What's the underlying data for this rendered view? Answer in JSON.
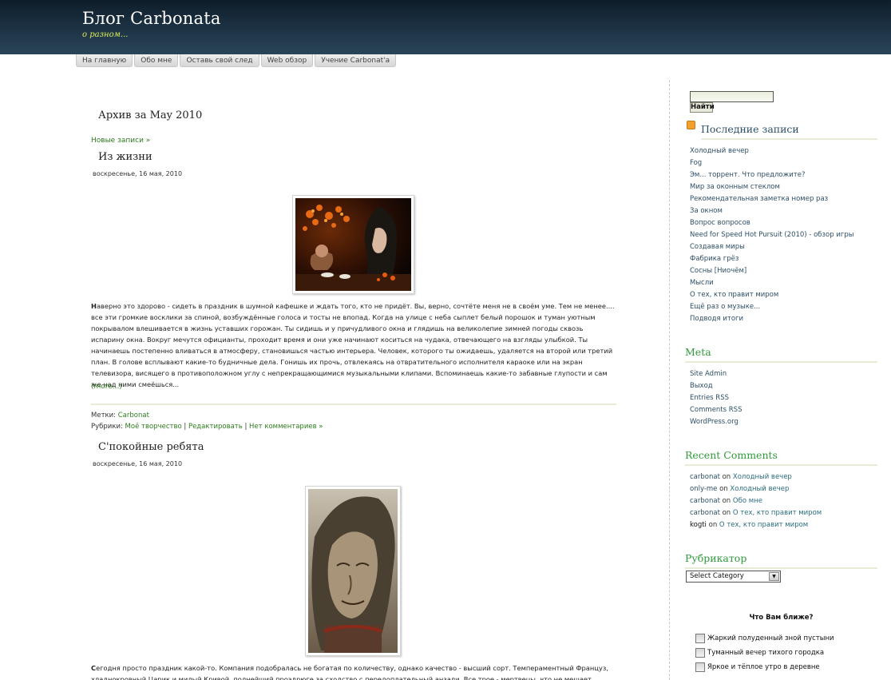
{
  "header": {
    "title": "Блог Carbonata",
    "tagline": "о разном..."
  },
  "nav": {
    "items": [
      {
        "label": "На главную"
      },
      {
        "label": "Обо мне"
      },
      {
        "label": "Оставь свой след"
      },
      {
        "label": "Web обзор"
      },
      {
        "label": "Учение Carbonat'a"
      }
    ]
  },
  "main": {
    "archive_title": "Архив за May 2010",
    "newer_link": "Новые записи »",
    "posts": [
      {
        "title": "Из жизни",
        "date": "воскресенье, 16 мая, 2010",
        "body_lead": "Н",
        "body": "аверно это здорово - сидеть в праздник в шумной кафешке и ждать того, кто не придёт. Вы, верно, сочтёте меня не в своём уме. Тем не менее.... все эти громкие восклики за спиной, возбуждённые голоса и тосты не впопад. Когда на улице с неба сыплет белый порошок и туман уютным покрывалом влешивается в жизнь уставших горожан. Ты сидишь и у причудливого окна и глядишь на великолепие зимней погоды сквозь испарину окна. Вокруг мечутся официанты, проходит время и они уже начинают коситься на чудака, отвечающего на взгляды улыбкой. Ты начинаешь постепенно вливаться в атмосферу, становишься частью интерьера. Человек, которого ты ожидаешь, удаляется на второй или третий план. В голове всплывают какие-то будничные дела. Гонишь их прочь, отвлекаясь на отвратительного исполнителя караоке или на экран телевизора, висящего в противоположном углу с непрекращающимися музыкальными клипами. Вспоминаешь какие-то забавные глупости и сам же над ними смеёшься...",
        "more": "(more...)",
        "tags_label": "Метки:",
        "tags": "Carbonat",
        "cats_label": "Рубрики:",
        "cats": "Моё творчество",
        "edit": "Редактировать",
        "comments": "Нет комментариев »"
      },
      {
        "title": "С'покойные ребята",
        "date": "воскресенье, 16 мая, 2010",
        "body_lead": "С",
        "body": "егодня просто праздник какой-то. Компания подобралась не богатая по  количеству, однако качество - высший сорт. Темпераментный Француз, хладнокровный Царик и милый Кривой, полнейший проэдрюге за сходство с  передоплательный анзали. Все трое - мертвецы, что не мешает играть в"
      }
    ]
  },
  "sidebar": {
    "search_button": "Найти",
    "recent_posts": {
      "title": "Последние записи",
      "items": [
        "Холодный вечер",
        "Fog",
        "Эм... торрент. Что предложите?",
        "Мир за оконным стеклом",
        "Рекомендательная заметка номер раз",
        "За окном",
        "Вопрос вопросов",
        "Need for Speed Hot Pursuit (2010) - обзор игры",
        "Создавая миры",
        "Фабрика грёз",
        "Сосны [Ниочём]",
        "Мысли",
        "О тех, кто правит миром",
        "Ещё раз о музыке...",
        "Подводя итоги"
      ]
    },
    "meta": {
      "title": "Meta",
      "items": [
        "Site Admin",
        "Выход",
        "Entries RSS",
        "Comments RSS",
        "WordPress.org"
      ]
    },
    "recent_comments": {
      "title": "Recent Comments",
      "on": "on",
      "items": [
        {
          "who": "carbonat",
          "target": "Холодный вечер"
        },
        {
          "who": "only-me",
          "target": "Холодный вечер"
        },
        {
          "who": "carbonat",
          "target": "Обо мне"
        },
        {
          "who": "carbonat",
          "target": "О тех, кто правит миром"
        },
        {
          "who": "kogti",
          "target": "О тех, кто правит миром"
        }
      ]
    },
    "categories": {
      "title": "Рубрикатор",
      "selected": "Select Category"
    },
    "poll": {
      "question": "Что Вам ближе?",
      "options": [
        "Жаркий полуденный зной пустыни",
        "Туманный вечер тихого городка",
        "Яркое и тёплое утро в деревне"
      ]
    }
  },
  "colors": {
    "link_green": "#2e7d1e",
    "sidebar_link": "#2c4e66",
    "widget_title": "#2f9a3a",
    "header_dark": "#1d3446",
    "tagline": "#d8ea5a"
  }
}
